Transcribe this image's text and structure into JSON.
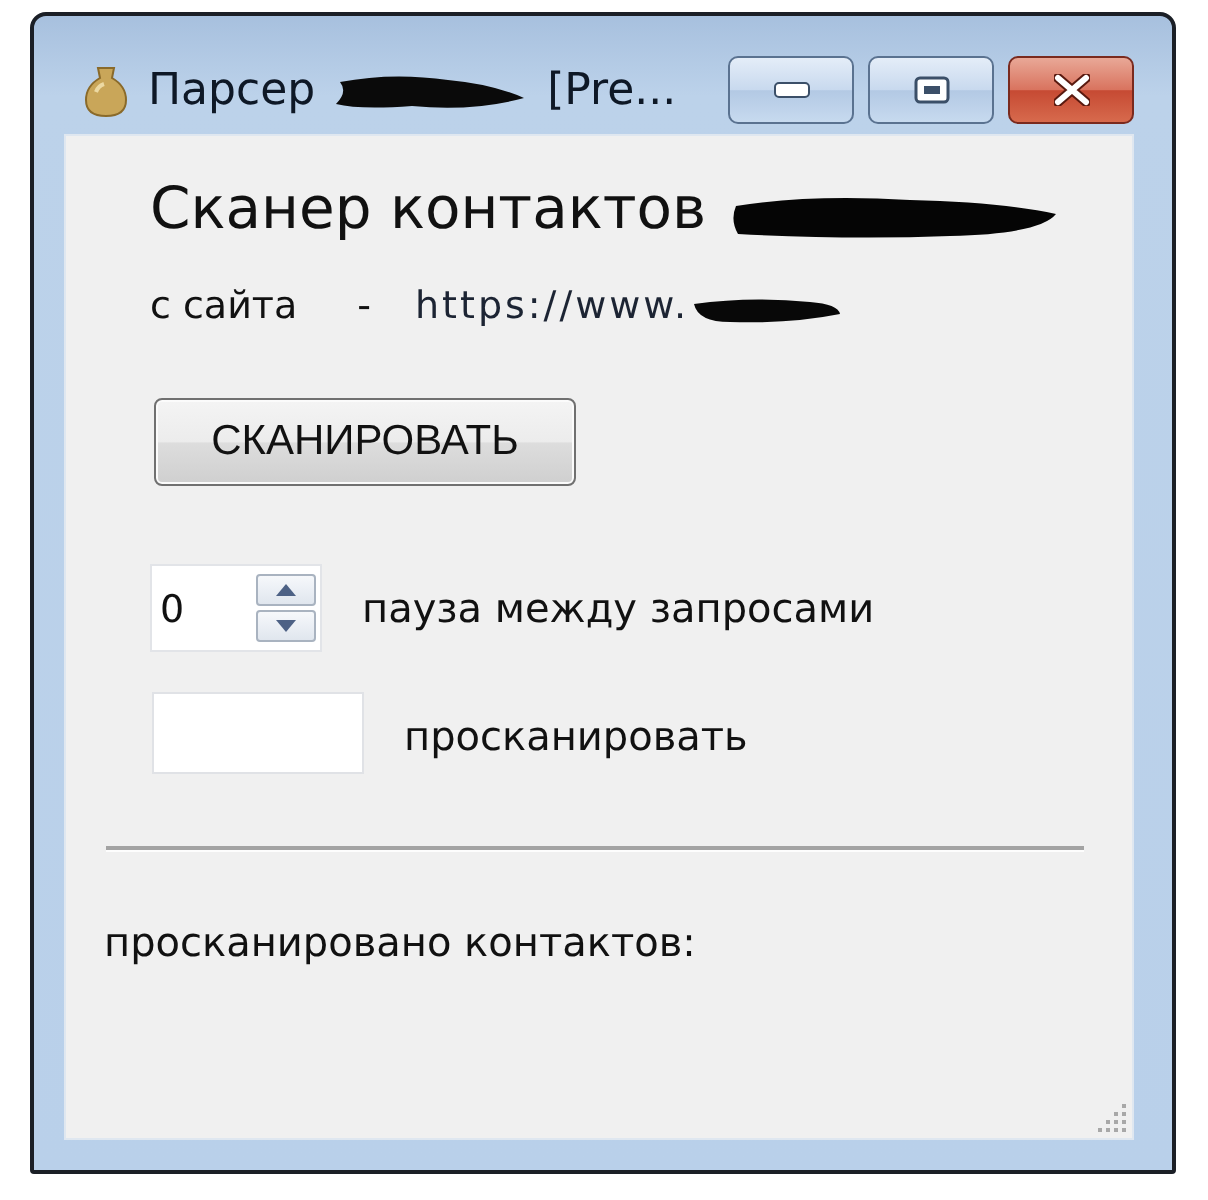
{
  "window": {
    "title": "Парсер",
    "title_redacted": true,
    "title_suffix": "[Pre...",
    "buttons": [
      {
        "kind": "minimize"
      },
      {
        "kind": "maximize"
      },
      {
        "kind": "close"
      }
    ]
  },
  "heading": {
    "text": "Сканер контактов",
    "redacted": true
  },
  "source": {
    "label": "с сайта",
    "separator": "-",
    "url": "https://www.",
    "redacted": true
  },
  "scan_button": "СКАНИРОВАТЬ",
  "pause": {
    "value": "0",
    "label": "пауза между запросами"
  },
  "scan_count": {
    "label": "просканировать"
  },
  "result": {
    "label": "просканировано контактов:"
  }
}
